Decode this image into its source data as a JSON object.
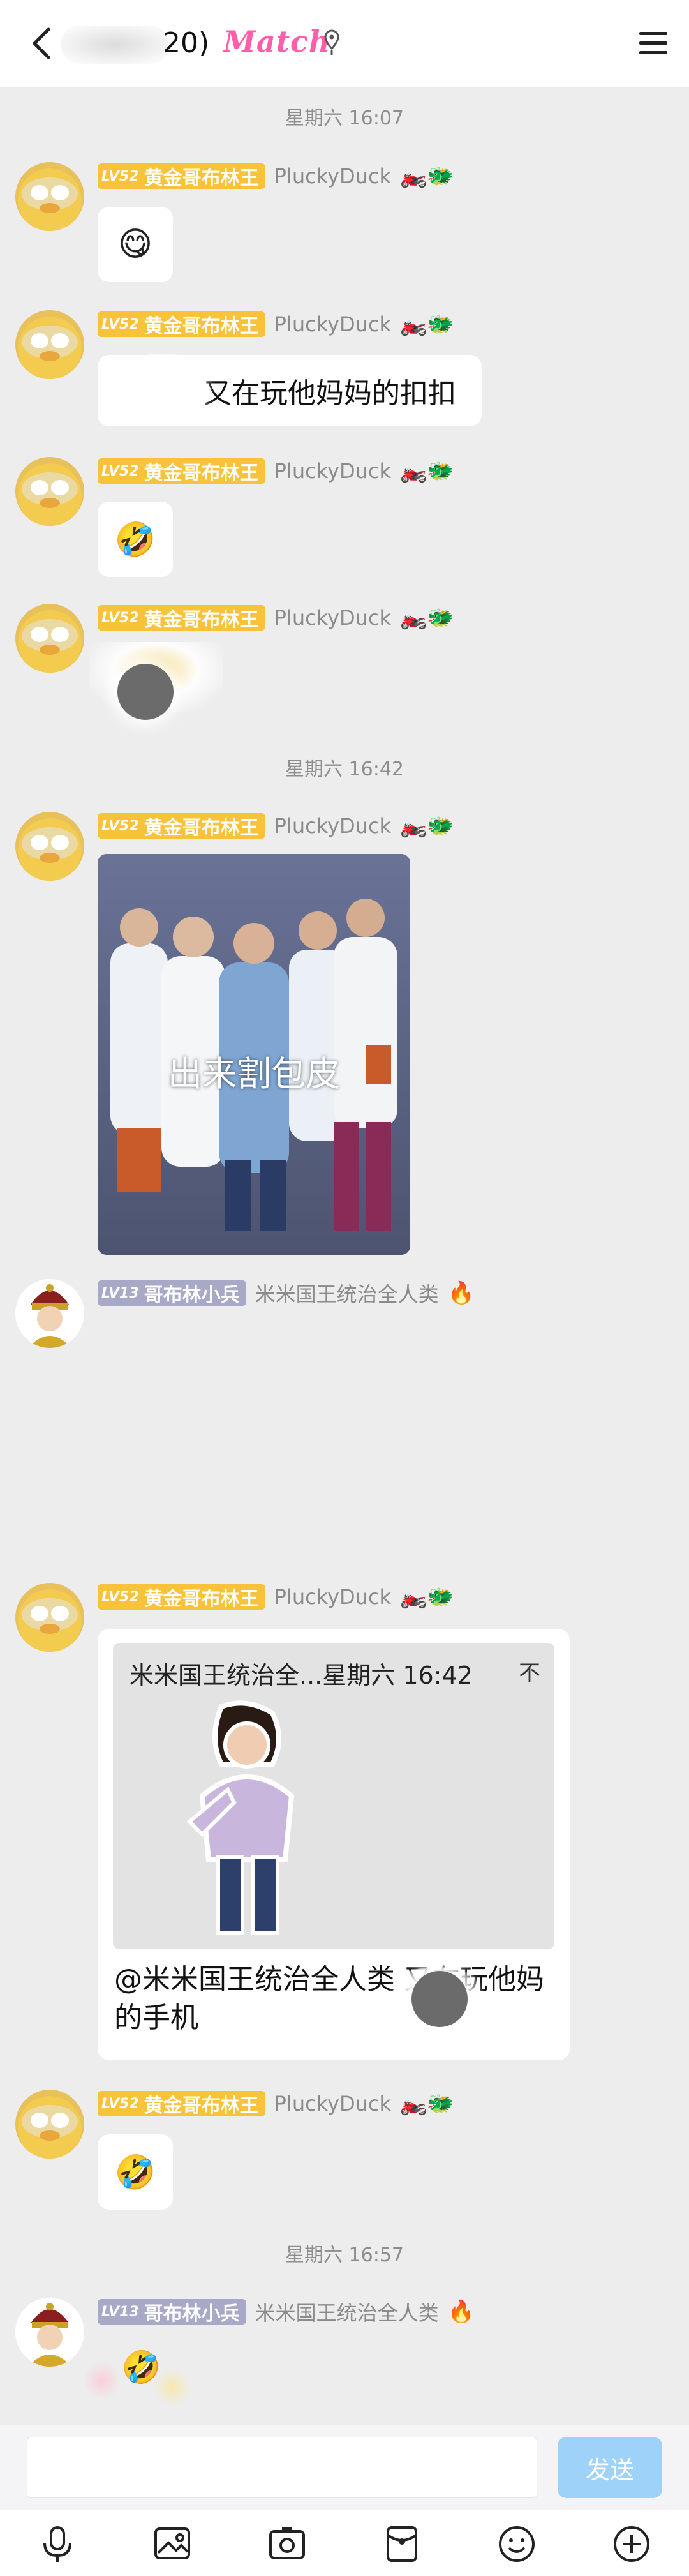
{
  "header": {
    "member_count": "20)",
    "group_tag": "Match"
  },
  "timestamps": [
    "星期六 16:07",
    "星期六 16:42",
    "星期六 16:57"
  ],
  "users": {
    "goblin_king": {
      "level": "LV52",
      "title": "黄金哥布林王",
      "nickname": "PluckyDuck",
      "deco": "🏍️🐲"
    },
    "goblin_soldier": {
      "level": "LV13",
      "title": "哥布林小兵",
      "nickname": "米米国王统治全人类",
      "deco": "🔥"
    }
  },
  "messages": {
    "m1_emoji": "😋",
    "m2_text": "又在玩他妈妈的扣扣",
    "m3_emoji": "🤣",
    "m5_photo_caption": "出来割包皮",
    "m7_reply_quote_head": "米米国王统治全...星期六 16:42",
    "m7_reply_quote_close": "不",
    "m7_reply_body": "@米米国王统治全人类              又在玩他妈的手机",
    "m8_emoji": "🤣",
    "m9_emoji": "🤣"
  },
  "composer": {
    "send_label": "发送",
    "input_value": ""
  },
  "toolbar_icons": [
    "microphone-icon",
    "image-icon",
    "camera-icon",
    "red-packet-icon",
    "emoji-icon",
    "plus-icon"
  ],
  "colors": {
    "accent": "#ff5fa8",
    "gold_badge": "#f8c33a",
    "grey_badge": "#a7a9c6",
    "send_button": "#9fd2f8"
  }
}
